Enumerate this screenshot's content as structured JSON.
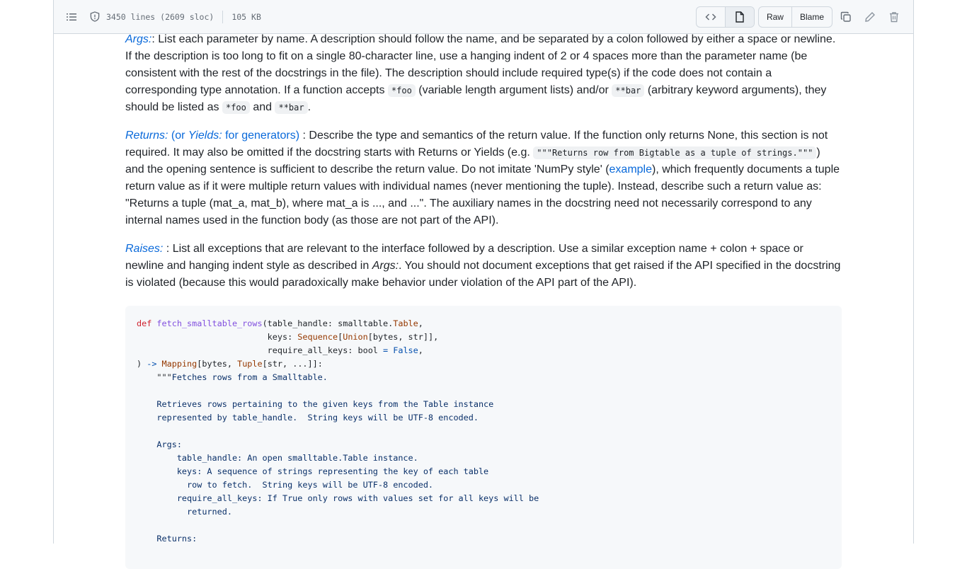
{
  "file_header": {
    "lines_info": "3450 lines (2609 sloc)",
    "size": "105 KB",
    "raw_label": "Raw",
    "blame_label": "Blame"
  },
  "icons": {
    "toc": "list-unordered-icon",
    "shield": "shield-icon",
    "code_view": "code-icon",
    "preview": "file-icon",
    "copy": "copy-icon",
    "edit": "pencil-icon",
    "delete": "trash-icon"
  },
  "doc": {
    "args": {
      "term": "Args:",
      "t1": ": List each parameter by name. A description should follow the name, and be separated by a colon followed by either a space or newline. If the description is too long to fit on a single 80-character line, use a hanging indent of 2 or 4 spaces more than the parameter name (be consistent with the rest of the docstrings in the file). The description should include required type(s) if the code does not contain a corresponding type annotation. If a function accepts ",
      "c1": "*foo",
      "t2": " (variable length argument lists) and/or ",
      "c2": "**bar",
      "t3": " (arbitrary keyword arguments), they should be listed as ",
      "c3": "*foo",
      "t4": " and ",
      "c4": "**bar",
      "t5": "."
    },
    "returns": {
      "term1": "Returns:",
      "mid": " (or ",
      "term2": "Yields:",
      "tail": " for generators)",
      "t1": " : Describe the type and semantics of the return value. If the function only returns None, this section is not required. It may also be omitted if the docstring starts with Returns or Yields (e.g. ",
      "c1": "\"\"\"Returns row from Bigtable as a tuple of strings.\"\"\"",
      "t2": ") and the opening sentence is sufficient to describe the return value. Do not imitate 'NumPy style' (",
      "link": "example",
      "t3": "), which frequently documents a tuple return value as if it were multiple return values with individual names (never mentioning the tuple). Instead, describe such a return value as: \"Returns a tuple (mat_a, mat_b), where mat_a is ..., and ...\". The auxiliary names in the docstring need not necessarily correspond to any internal names used in the function body (as those are not part of the API)."
    },
    "raises": {
      "term": "Raises:",
      "t1": " : List all exceptions that are relevant to the interface followed by a description. Use a similar exception name + colon + space or newline and hanging indent style as described in ",
      "em": "Args:",
      "t2": ". You should not document exceptions that get raised if the API specified in the docstring is violated (because this would paradoxically make behavior under violation of the API part of the API)."
    }
  },
  "code": {
    "def": "def",
    "fname": "fetch_smalltable_rows",
    "l1a": "(table_handle: smalltable.",
    "l1b": "Table",
    "l1c": ",",
    "l2a": "                          keys: ",
    "l2b": "Sequence",
    "l2c": "[",
    "l2d": "Union",
    "l2e": "[bytes, str]],",
    "l3a": "                          require_all_keys: bool ",
    "l3b": "=",
    "l3c": " ",
    "l3d": "False",
    "l3e": ",",
    "l4a": ") ",
    "l4b": "->",
    "l4c": " ",
    "l4d": "Mapping",
    "l4e": "[bytes, ",
    "l4f": "Tuple",
    "l4g": "[str, ...]]:",
    "doc_open": "    \"\"\"",
    "doc_first": "Fetches rows from a Smalltable.",
    "doc_body": "\n\n    Retrieves rows pertaining to the given keys from the Table instance\n    represented by table_handle.  String keys will be UTF-8 encoded.\n\n    Args:\n        table_handle: An open smalltable.Table instance.\n        keys: A sequence of strings representing the key of each table\n          row to fetch.  String keys will be UTF-8 encoded.\n        require_all_keys: If True only rows with values set for all keys will be\n          returned.\n\n    Returns:"
  }
}
